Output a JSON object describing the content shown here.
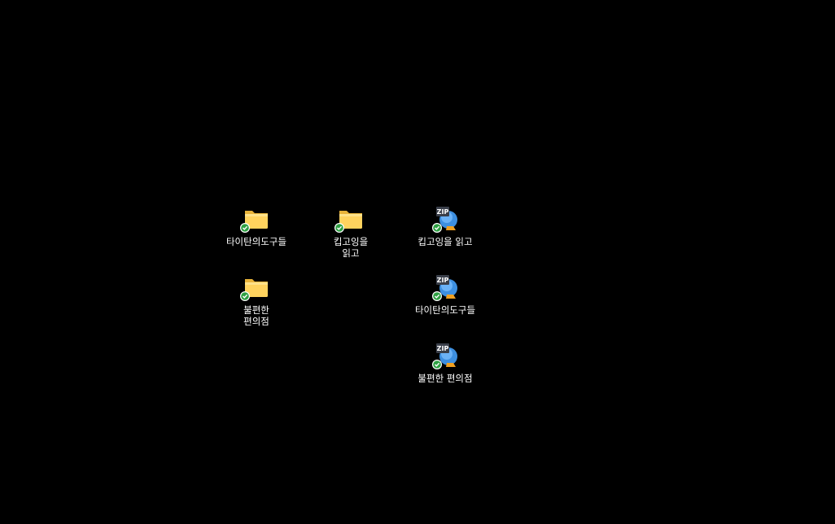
{
  "desktop": {
    "items": [
      {
        "label": "타이탄의도구들",
        "type": "folder",
        "icon": "folder-icon",
        "status": "synced-check-icon"
      },
      {
        "label": "킵고잉을\n읽고",
        "type": "folder",
        "icon": "folder-icon",
        "status": "synced-check-icon"
      },
      {
        "label": "킵고잉을 읽고",
        "type": "zip",
        "icon": "zip-archive-icon",
        "badge": "ZIP",
        "status": "synced-check-icon"
      },
      {
        "label": "불편한\n편의점",
        "type": "folder",
        "icon": "folder-icon",
        "status": "synced-check-icon"
      },
      {
        "label": "타이탄의도구들",
        "type": "zip",
        "icon": "zip-archive-icon",
        "badge": "ZIP",
        "status": "synced-check-icon"
      },
      {
        "label": "불편한 편의점",
        "type": "zip",
        "icon": "zip-archive-icon",
        "badge": "ZIP",
        "status": "synced-check-icon"
      }
    ]
  },
  "colors": {
    "background": "#000000",
    "folder": "#f8c94c",
    "folder_light": "#ffdb72",
    "zip_blue": "#3d8fe0",
    "check": "#2ea043"
  }
}
